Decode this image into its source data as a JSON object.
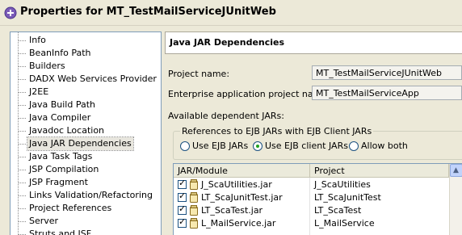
{
  "window": {
    "title": "Properties for MT_TestMailServiceJUnitWeb",
    "icon": "properties-icon"
  },
  "sidebar": {
    "items": [
      {
        "label": "Info"
      },
      {
        "label": "BeanInfo Path"
      },
      {
        "label": "Builders"
      },
      {
        "label": "DADX Web Services Provider"
      },
      {
        "label": "J2EE"
      },
      {
        "label": "Java Build Path"
      },
      {
        "label": "Java Compiler"
      },
      {
        "label": "Javadoc Location"
      },
      {
        "label": "Java JAR Dependencies",
        "selected": true
      },
      {
        "label": "Java Task Tags"
      },
      {
        "label": "JSP Compilation"
      },
      {
        "label": "JSP Fragment"
      },
      {
        "label": "Links Validation/Refactoring"
      },
      {
        "label": "Project References"
      },
      {
        "label": "Server"
      },
      {
        "label": "Struts and JSF"
      }
    ]
  },
  "main": {
    "header_title": "Java JAR Dependencies",
    "project_name_label": "Project name:",
    "project_name_value": "MT_TestMailServiceJUnitWeb",
    "enterprise_label": "Enterprise application project name:",
    "enterprise_value": "MT_TestMailServiceApp",
    "available_label": "Available dependent JARs:",
    "group_label": "References to EJB JARs with EJB Client JARs",
    "radios": [
      {
        "label": "Use EJB JARs",
        "checked": false
      },
      {
        "label": "Use EJB client JARs",
        "checked": true
      },
      {
        "label": "Allow both",
        "checked": false
      }
    ],
    "table": {
      "columns": [
        "JAR/Module",
        "Project"
      ],
      "rows": [
        {
          "jar": "J_ScaUtilities.jar",
          "project": "J_ScaUtilities",
          "checked": true
        },
        {
          "jar": "LT_ScaJunitTest.jar",
          "project": "LT_ScaJunitTest",
          "checked": true
        },
        {
          "jar": "LT_ScaTest.jar",
          "project": "LT_ScaTest",
          "checked": true
        },
        {
          "jar": "L_MailService.jar",
          "project": "L_MailService",
          "checked": true
        }
      ]
    }
  },
  "colors": {
    "window_bg": "#ece9d8",
    "tree_border": "#7f9db9",
    "radio_dot": "#21a121"
  }
}
